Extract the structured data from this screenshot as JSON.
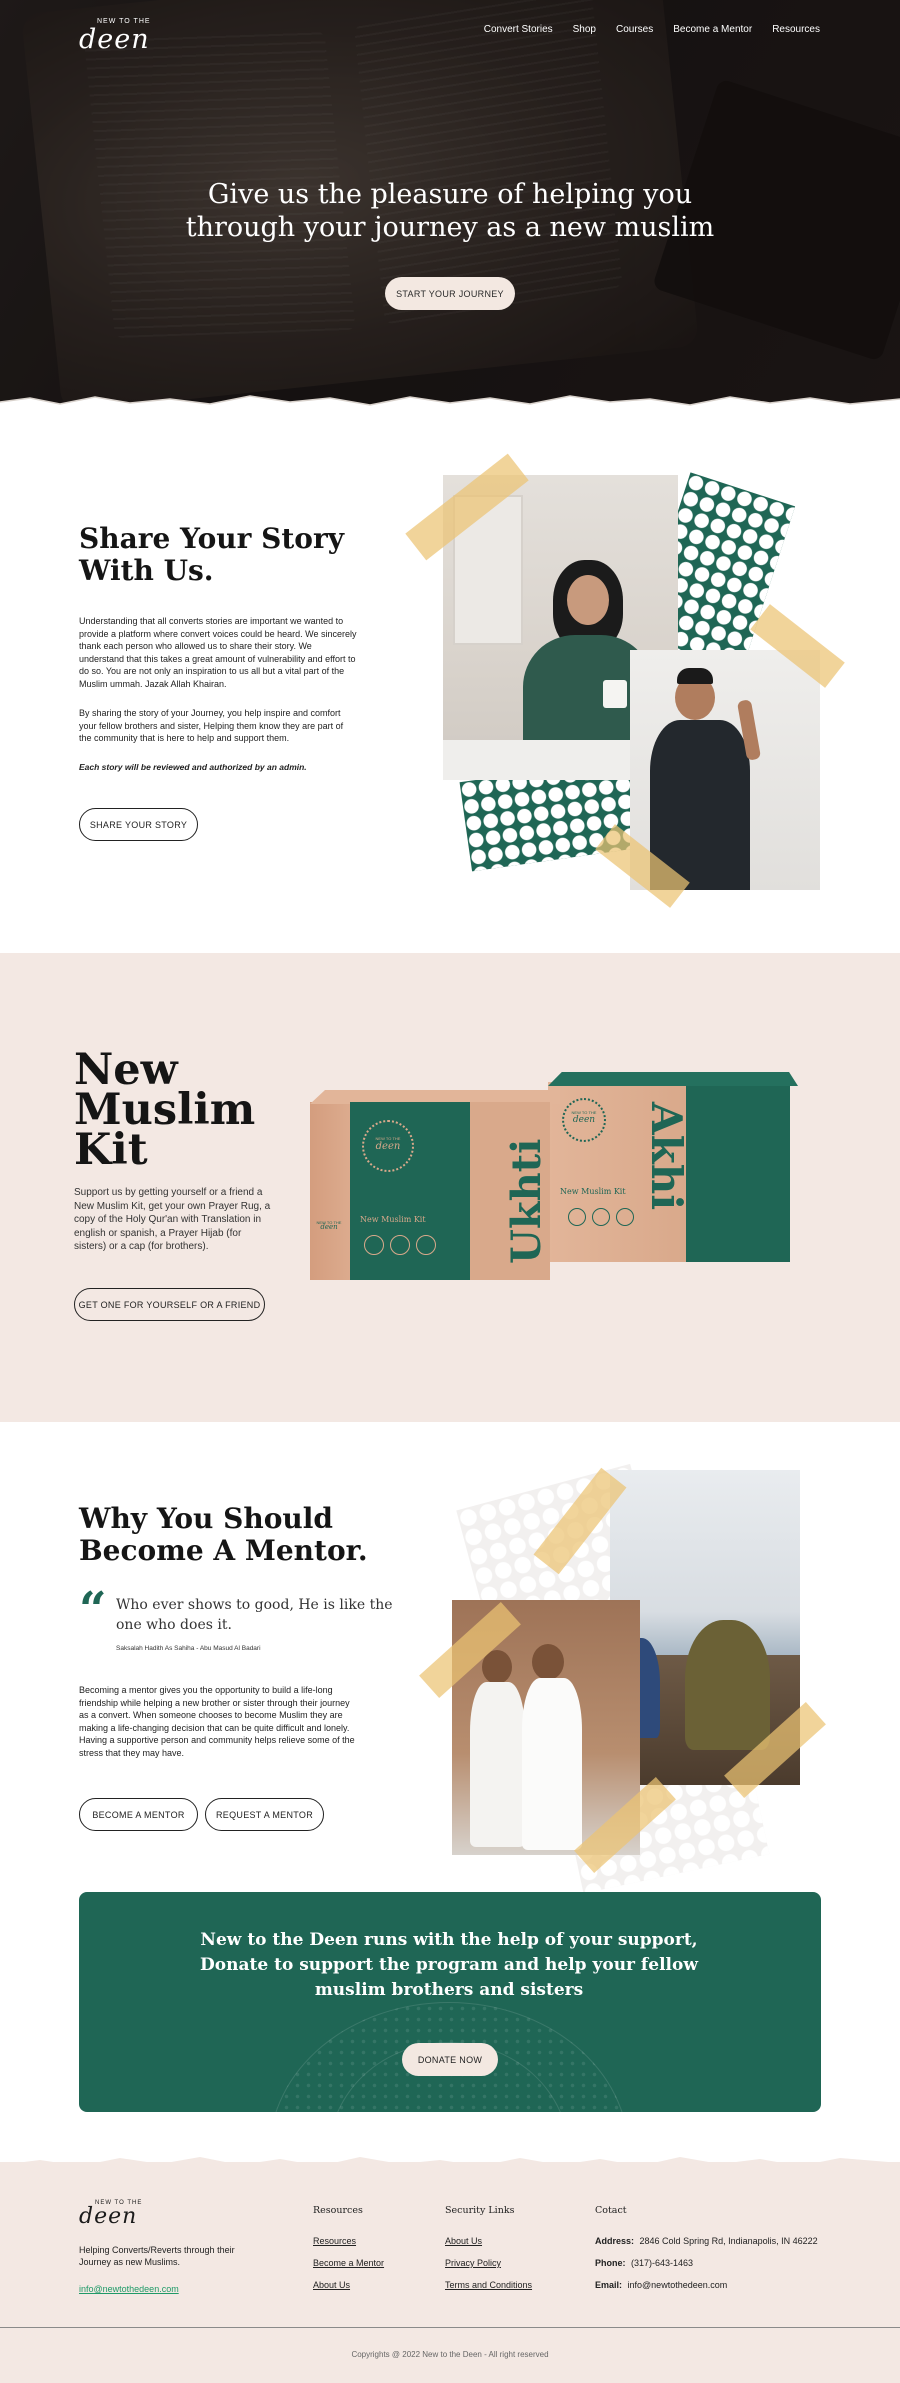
{
  "brand": {
    "small": "NEW TO THE",
    "big": "deen"
  },
  "nav": [
    "Convert Stories",
    "Shop",
    "Courses",
    "Become a Mentor",
    "Resources"
  ],
  "hero": {
    "title": "Give us the pleasure of helping you through your journey as a new muslim",
    "button": "START YOUR JOURNEY"
  },
  "story": {
    "title": "Share Your Story With Us.",
    "p1": "Understanding that all converts stories are important we wanted to provide a platform where convert voices could be heard. We sincerely thank each person who allowed us to share their story. We understand that this takes a great amount of vulnerability and effort to do so. You are not only an inspiration to us all but a vital part of the Muslim ummah. Jazak Allah Khairan.",
    "p2": "By sharing the story of your Journey, you help inspire and comfort your fellow brothers and sister, Helping them know they are part of the community that is here to help and support them.",
    "note": "Each story will be reviewed and authorized by an admin.",
    "button": "SHARE YOUR STORY"
  },
  "kit": {
    "title": "New Muslim Kit",
    "text": "Support us by getting yourself or a friend a New Muslim Kit, get your own Prayer Rug, a copy of the Holy Qur'an with Translation in english or spanish, a Prayer Hijab (for sisters) or a cap (for brothers).",
    "button": "GET ONE FOR YOURSELF  OR  A FRIEND",
    "box_left": {
      "name": "Ukhti",
      "caption": "New Muslim Kit",
      "logo_small": "NEW TO THE",
      "logo_big": "deen"
    },
    "box_right": {
      "name": "Akhi",
      "caption": "New Muslim Kit",
      "logo_small": "NEW TO THE",
      "logo_big": "deen"
    }
  },
  "mentor": {
    "title": "Why You Should Become A Mentor.",
    "quote": "Who ever shows to good, He is like the one who does it.",
    "quote_source": "Saksalah Hadith As Sahiha - Abu Masud Al Badari",
    "text": "Becoming a mentor gives you the opportunity to build a life-long friendship while helping a new brother or sister through their journey as a convert. When someone chooses to become Muslim they are making a life-changing decision that can be quite difficult and lonely. Having a supportive person and community helps relieve some of the stress that they may have.",
    "button1": "BECOME A MENTOR",
    "button2": "REQUEST A MENTOR"
  },
  "donate": {
    "title": "New to the Deen runs with the help of your support, Donate to support the program and help your fellow muslim brothers and sisters",
    "button": "DONATE NOW"
  },
  "footer": {
    "tagline": "Helping Converts/Reverts through their Journey as new Muslims.",
    "email": "info@newtothedeen.com",
    "resources_head": "Resources",
    "resources": [
      "Resources",
      "Become a Mentor",
      "About Us"
    ],
    "security_head": "Security Links",
    "security": [
      "About Us",
      "Privacy Policy",
      "Terms and Conditions"
    ],
    "contact_head": "Cotact",
    "address_label": "Address:",
    "address": "2846 Cold Spring Rd, Indianapolis, IN 46222",
    "phone_label": "Phone:",
    "phone": "(317)-643-1463",
    "email_label": "Email:",
    "email2": "info@newtothedeen.com",
    "copyright": "Copyrights @ 2022 New to the Deen - All right reserved"
  },
  "colors": {
    "green": "#1f6655",
    "cream": "#f3e8e3",
    "tan": "#d9a98b",
    "tape": "#ebc373"
  }
}
